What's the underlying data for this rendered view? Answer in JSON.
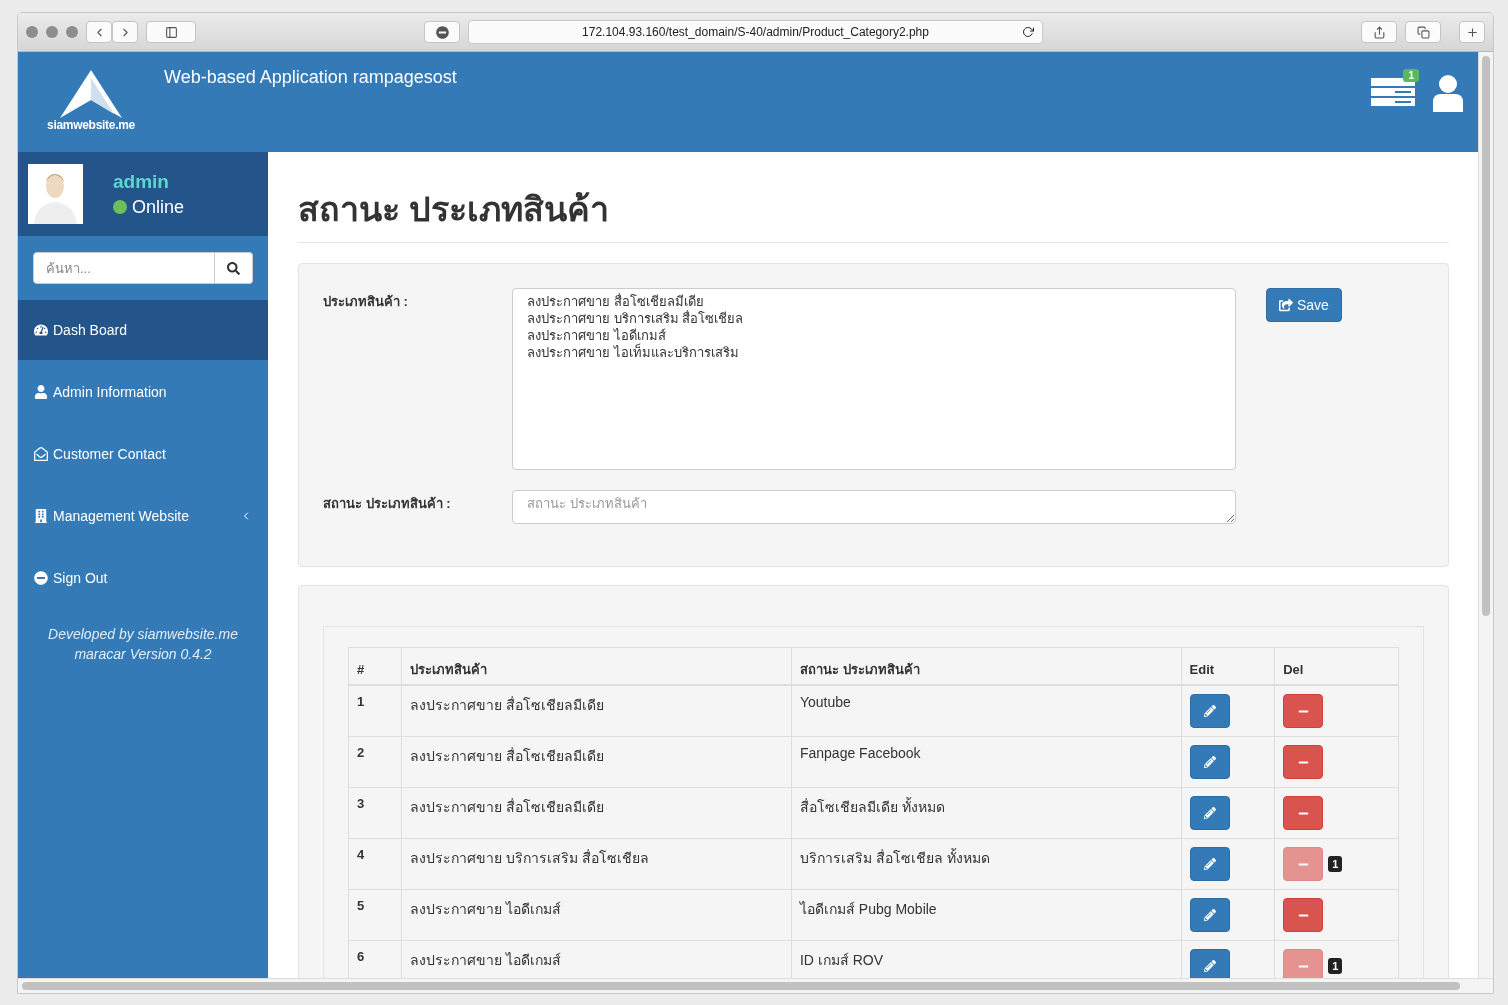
{
  "browser": {
    "url": "172.104.93.160/test_domain/S-40/admin/Product_Category2.php"
  },
  "header": {
    "logo_text": "siamwebsite.me",
    "title": "Web-based Application rampagesost",
    "notification_count": "1"
  },
  "user": {
    "name": "admin",
    "status": "Online",
    "online": true
  },
  "search": {
    "placeholder": "ค้นหา..."
  },
  "sidebar": {
    "items": [
      {
        "label": "Dash Board",
        "selected": true,
        "submenu": false
      },
      {
        "label": "Admin Information",
        "selected": false,
        "submenu": false
      },
      {
        "label": "Customer Contact",
        "selected": false,
        "submenu": false
      },
      {
        "label": "Management Website",
        "selected": false,
        "submenu": true
      },
      {
        "label": "Sign Out",
        "selected": false,
        "submenu": false
      }
    ],
    "footer": [
      "Developed by siamwebsite.me",
      "maracar Version 0.4.2"
    ]
  },
  "page_title": "สถานะ ประเภทสินค้า",
  "form": {
    "category_label": "ประเภทสินค้า :",
    "category_value": "ลงประกาศขาย สื่อโซเชียลมีเดีย\nลงประกาศขาย บริการเสริม สื่อโซเชียล\nลงประกาศขาย ไอดีเกมส์\nลงประกาศขาย ไอเท็มและบริการเสริม",
    "status_label": "สถานะ ประเภทสินค้า :",
    "status_placeholder": "สถานะ ประเภทสินค้า",
    "save": "Save"
  },
  "table": {
    "columns": [
      "#",
      "ประเภทสินค้า",
      "สถานะ ประเภทสินค้า",
      "Edit",
      "Del"
    ],
    "rows": [
      {
        "no": "1",
        "category": "ลงประกาศขาย สื่อโซเชียลมีเดีย",
        "status": "Youtube",
        "delete_disabled": false
      },
      {
        "no": "2",
        "category": "ลงประกาศขาย สื่อโซเชียลมีเดีย",
        "status": "Fanpage Facebook",
        "delete_disabled": false
      },
      {
        "no": "3",
        "category": "ลงประกาศขาย สื่อโซเชียลมีเดีย",
        "status": "สื่อโซเชียลมีเดีย ทั้งหมด",
        "delete_disabled": false
      },
      {
        "no": "4",
        "category": "ลงประกาศขาย บริการเสริม สื่อโซเชียล",
        "status": "บริการเสริม สื่อโซเชียล ทั้งหมด",
        "delete_disabled": true,
        "badge": "1"
      },
      {
        "no": "5",
        "category": "ลงประกาศขาย ไอดีเกมส์",
        "status": "ไอดีเกมส์ Pubg Mobile",
        "delete_disabled": false
      },
      {
        "no": "6",
        "category": "ลงประกาศขาย ไอดีเกมส์",
        "status": "ID เกมส์ ROV",
        "delete_disabled": true,
        "badge": "1"
      }
    ]
  }
}
